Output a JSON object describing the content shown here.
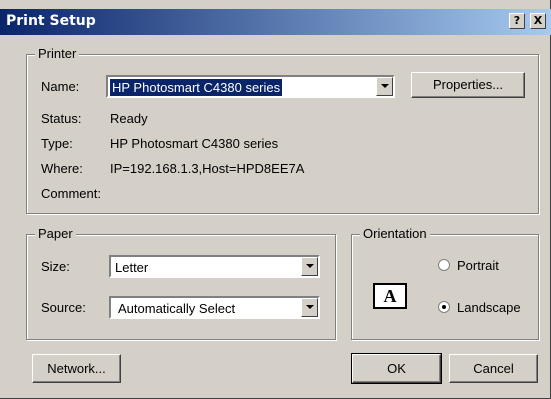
{
  "window": {
    "title": "Print Setup",
    "help_glyph": "?",
    "close_glyph": "X"
  },
  "printer": {
    "legend": "Printer",
    "name_label": "Name:",
    "name_value": "HP Photosmart C4380 series",
    "properties_label": "Properties...",
    "status_label": "Status:",
    "status_value": "Ready",
    "type_label": "Type:",
    "type_value": "HP Photosmart C4380 series",
    "where_label": "Where:",
    "where_value": "IP=192.168.1.3,Host=HPD8EE7A",
    "comment_label": "Comment:",
    "comment_value": ""
  },
  "paper": {
    "legend": "Paper",
    "size_label": "Size:",
    "size_value": "Letter",
    "source_label": "Source:",
    "source_value": "Automatically Select"
  },
  "orientation": {
    "legend": "Orientation",
    "icon_letter": "A",
    "portrait_label": "Portrait",
    "landscape_label": "Landscape",
    "selected": "Landscape"
  },
  "buttons": {
    "network": "Network...",
    "ok": "OK",
    "cancel": "Cancel"
  },
  "colors": {
    "titlebar_start": "#0a246a",
    "titlebar_end": "#a6caf0",
    "dialog_bg": "#d4d0c8",
    "selection": "#0a246a"
  }
}
